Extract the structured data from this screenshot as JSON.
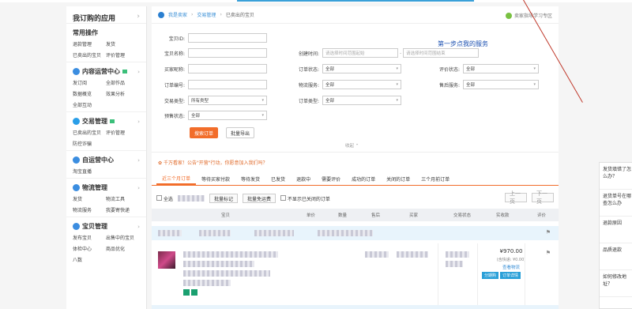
{
  "sidebar": {
    "title": "我订购的应用",
    "common": {
      "title": "常用操作",
      "items": [
        "退款管理",
        "发货",
        "已卖出的宝贝",
        "评价管理"
      ]
    },
    "content": {
      "title": "内容运营中心",
      "items": [
        "发订阅",
        "全部作品",
        "数据概览",
        "效果分析",
        "全部互动"
      ]
    },
    "trade": {
      "title": "交易管理",
      "items": [
        "已卖出的宝贝",
        "评价管理",
        "防控诈骗"
      ]
    },
    "custom": {
      "title": "自运营中心",
      "items": [
        "淘宝直播"
      ]
    },
    "logistics": {
      "title": "物流管理",
      "items": [
        "发货",
        "物流工具",
        "物流服务",
        "我要寄快递"
      ]
    },
    "baby": {
      "title": "宝贝管理",
      "items": [
        "发布宝贝",
        "出售中的宝贝",
        "体检中心",
        "商品优化",
        "八数"
      ]
    }
  },
  "breadcrumb": {
    "items": [
      "我是卖家",
      "交易管理",
      "已卖出的宝贝"
    ]
  },
  "help": "卖家指导学习专区",
  "form": {
    "order_id": "宝贝ID:",
    "item_name": "宝贝名称:",
    "create_time": "创建时间:",
    "time_start_ph": "请选择时间范围起始",
    "time_end_ph": "请选择时间范围结束",
    "buyer": "买家昵称:",
    "order_status": "订单状态:",
    "eval_status": "评价状态:",
    "order_no": "订单编号:",
    "logistics": "物流服务:",
    "after_sale": "售后服务:",
    "trade_type": "交易类型:",
    "order_type": "订单类型:",
    "presale": "预售状态:",
    "all": "全部",
    "all_types": "所有类型"
  },
  "annotation": "第一步点我的服务",
  "buttons": {
    "search": "搜索订单",
    "export": "批量导出",
    "collapse": "收起"
  },
  "notice": "千万看家！公告\"开营\"行动，你愿意加入我们吗？",
  "tabs": [
    "近三个月订单",
    "等待买家付款",
    "等待发货",
    "已发货",
    "退款中",
    "需要评价",
    "成功的订单",
    "关闭的订单",
    "三个月前订单"
  ],
  "toolbar": {
    "select_all": "全选",
    "mark": "批量标记",
    "free_ship": "批量免运费",
    "hide_closed": "不显示已关闭的订单",
    "prev": "上一页",
    "next": "下一页"
  },
  "table_headers": [
    "宝贝",
    "单价",
    "数量",
    "售后",
    "买家",
    "交易状态",
    "实收款",
    "评价"
  ],
  "order": {
    "price": "¥970.00",
    "shipping": "(含快递: ¥0.00)",
    "detail": "查看物流",
    "tags": [
      "分期购",
      "订单详情"
    ]
  },
  "chat": [
    "发货填错了怎么办？",
    "退货单号在哪查怎么办",
    "退款原因",
    "品质退款",
    "如何修改地址？"
  ]
}
